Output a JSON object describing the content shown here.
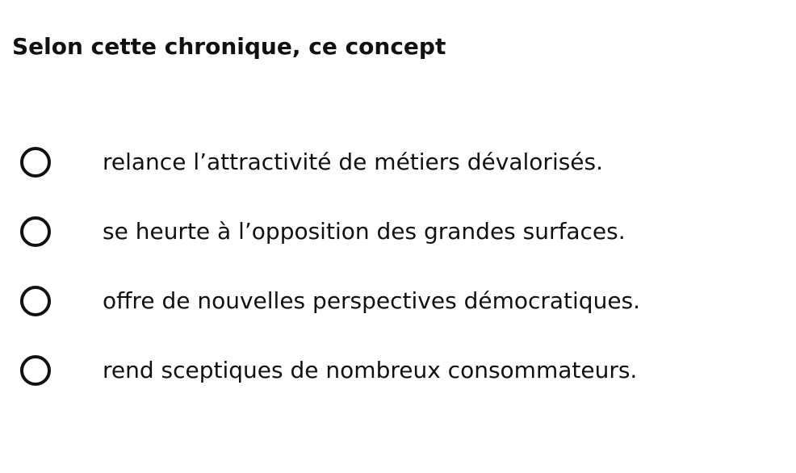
{
  "question": {
    "title": "Selon cette chronique, ce concept"
  },
  "options": [
    {
      "label": "relance l’attractivité de métiers dévalorisés."
    },
    {
      "label": "se heurte à l’opposition des grandes surfaces."
    },
    {
      "label": "offre de nouvelles perspectives démocratiques."
    },
    {
      "label": "rend sceptiques de nombreux consommateurs."
    }
  ]
}
